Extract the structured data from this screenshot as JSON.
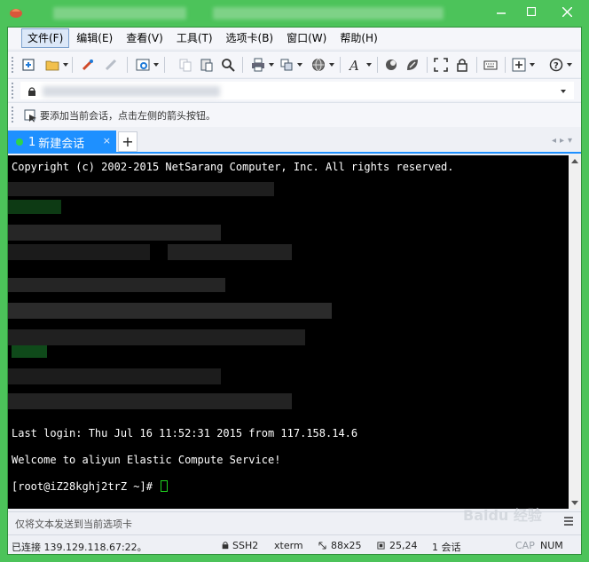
{
  "menu": [
    "文件(F)",
    "编辑(E)",
    "查看(V)",
    "工具(T)",
    "选项卡(B)",
    "窗口(W)",
    "帮助(H)"
  ],
  "hint": "要添加当前会话，点击左侧的箭头按钮。",
  "tab": {
    "number": "1",
    "label": "新建会话",
    "close": "×",
    "add": "+"
  },
  "terminal": {
    "line1": "Copyright (c) 2002-2015 NetSarang Computer, Inc. All rights reserved.",
    "last_login": "Last login: Thu Jul 16 11:52:31 2015 from 117.158.14.6",
    "welcome": "Welcome to aliyun Elastic Compute Service!",
    "prompt": "[root@iZ28kghj2trZ ~]# "
  },
  "sendbar": {
    "text": "仅将文本发送到当前选项卡"
  },
  "status": {
    "connected": "已连接 139.129.118.67:22。",
    "protocol": "SSH2",
    "term": "xterm",
    "size": "88x25",
    "pos": "25,24",
    "sessions": "1 会话",
    "cap": "CAP",
    "num": "NUM"
  },
  "watermark": {
    "text": "Baidu 经验"
  },
  "colors": {
    "window_frame": "#4cc35a",
    "tab_active": "#1e90ff",
    "terminal_bg": "#000000",
    "cursor": "#1fd11f"
  }
}
